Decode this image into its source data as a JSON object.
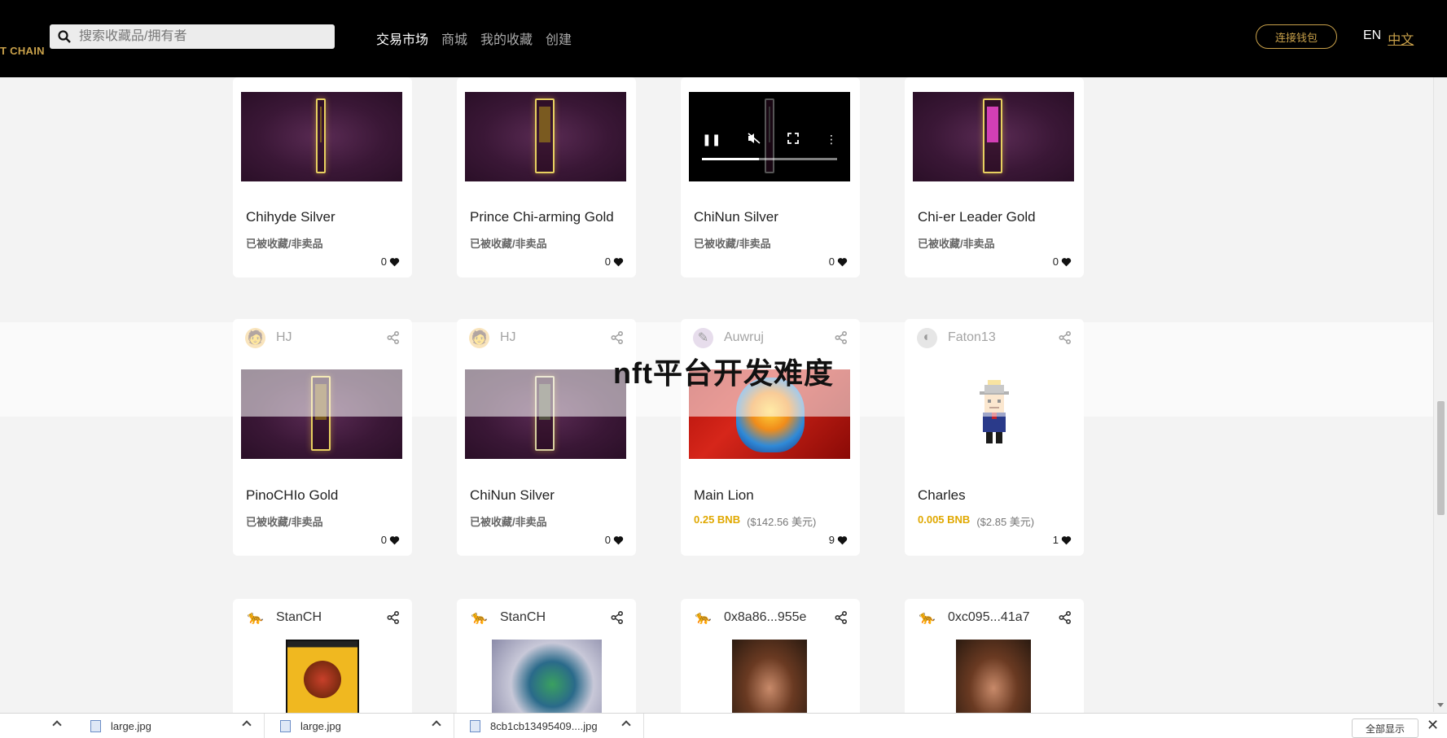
{
  "header": {
    "logo": "T CHAIN",
    "search_placeholder": "搜索收藏品/拥有者",
    "nav": [
      {
        "label": "交易市场",
        "active": true
      },
      {
        "label": "商城",
        "active": false
      },
      {
        "label": "我的收藏",
        "active": false
      },
      {
        "label": "创建",
        "active": false
      }
    ],
    "wallet_button": "连接钱包",
    "lang_en": "EN",
    "lang_zh": "中文"
  },
  "row1": [
    {
      "title": "Chihyde Silver",
      "status": "已被收藏/非卖品",
      "likes": "0"
    },
    {
      "title": "Prince Chi-arming Gold",
      "status": "已被收藏/非卖品",
      "likes": "0"
    },
    {
      "title": "ChiNun Silver",
      "status": "已被收藏/非卖品",
      "likes": "0"
    },
    {
      "title": "Chi-er Leader Gold",
      "status": "已被收藏/非卖品",
      "likes": "0"
    }
  ],
  "row2": [
    {
      "owner": "HJ",
      "title": "PinoCHIo Gold",
      "status": "已被收藏/非卖品",
      "likes": "0"
    },
    {
      "owner": "HJ",
      "title": "ChiNun Silver",
      "status": "已被收藏/非卖品",
      "likes": "0"
    },
    {
      "owner": "Auwruj",
      "title": "Main Lion",
      "price_bnb": "0.25 BNB",
      "price_usd": "($142.56 美元)",
      "likes": "9"
    },
    {
      "owner": "Faton13",
      "title": "Charles",
      "price_bnb": "0.005 BNB",
      "price_usd": "($2.85 美元)",
      "likes": "1"
    }
  ],
  "row3": [
    {
      "owner": "StanCH"
    },
    {
      "owner": "StanCH"
    },
    {
      "owner": "0x8a86...955e"
    },
    {
      "owner": "0xc095...41a7"
    }
  ],
  "watermark": "nft平台开发难度",
  "downloads": {
    "items": [
      "large.jpg",
      "large.jpg",
      "8cb1cb13495409....jpg"
    ],
    "show_all": "全部显示",
    "close": "✕"
  },
  "colors": {
    "accent": "#c9a14a",
    "price": "#e0a800",
    "header_bg": "#000000"
  }
}
